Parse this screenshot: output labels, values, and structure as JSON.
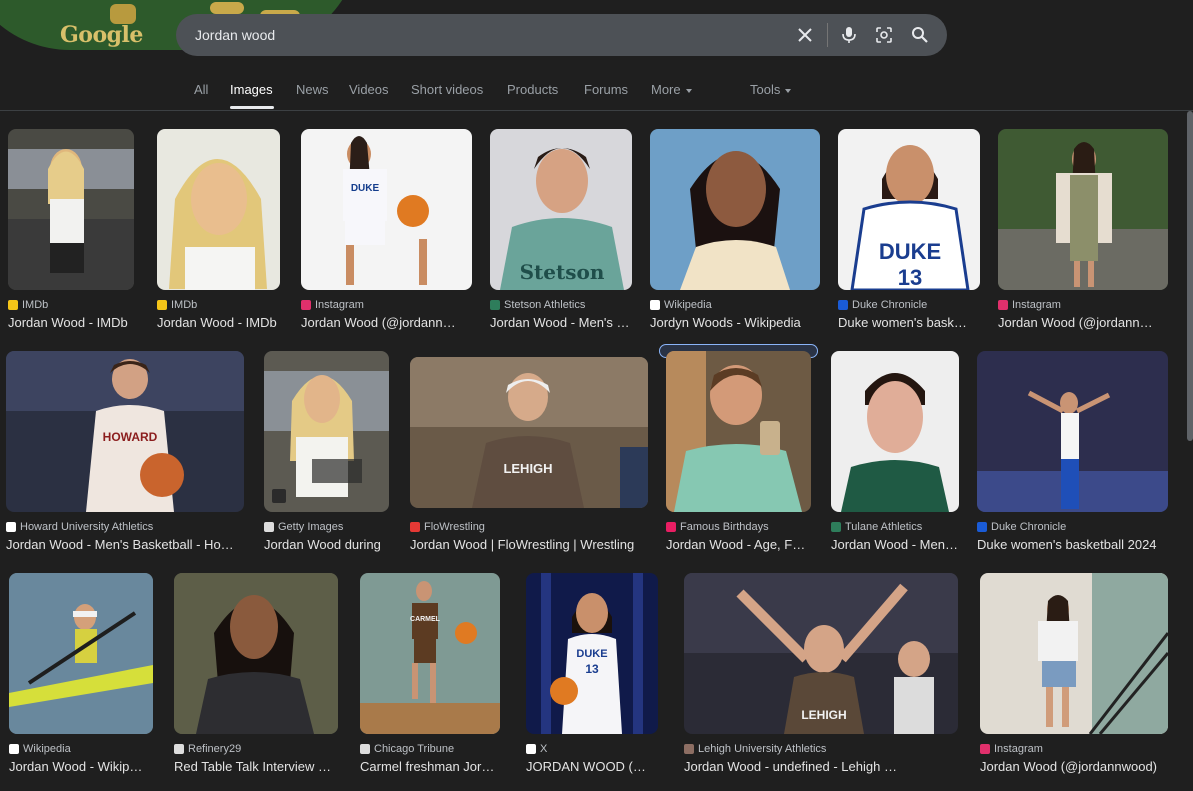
{
  "logo": {
    "text": "Google"
  },
  "search": {
    "value": "Jordan wood",
    "placeholder": ""
  },
  "icons": {
    "clear": "close-icon",
    "voice": "microphone-icon",
    "lens": "camera-lens-icon",
    "search": "search-icon"
  },
  "tabs": [
    {
      "label": "All"
    },
    {
      "label": "Images"
    },
    {
      "label": "News"
    },
    {
      "label": "Videos"
    },
    {
      "label": "Short videos"
    },
    {
      "label": "Products"
    },
    {
      "label": "Forums"
    },
    {
      "label": "More"
    },
    {
      "label": "Tools"
    }
  ],
  "results": [
    {
      "source": "IMDb",
      "title": "Jordan Wood - IMDb",
      "favicon_color": "#f5c518"
    },
    {
      "source": "IMDb",
      "title": "Jordan Wood - IMDb",
      "favicon_color": "#f5c518"
    },
    {
      "source": "Instagram",
      "title": "Jordan Wood (@jordannwood)",
      "favicon_color": "#e1306c"
    },
    {
      "source": "Stetson Athletics",
      "title": "Jordan Wood - Men's Basketball",
      "favicon_color": "#2e7d5b"
    },
    {
      "source": "Wikipedia",
      "title": "Jordyn Woods - Wikipedia",
      "favicon_color": "#ffffff"
    },
    {
      "source": "Duke Chronicle",
      "title": "Duke women's basketball",
      "favicon_color": "#1a5bd6"
    },
    {
      "source": "Instagram",
      "title": "Jordan Wood (@jordannwood)",
      "favicon_color": "#e1306c"
    },
    {
      "source": "Howard University Athletics",
      "title": "Jordan Wood - Men's Basketball - Howard",
      "favicon_color": "#ffffff"
    },
    {
      "source": "Getty Images",
      "title": "Jordan Wood during",
      "favicon_color": "#dddddd"
    },
    {
      "source": "FloWrestling",
      "title": "Jordan Wood | FloWrestling | Wrestling",
      "favicon_color": "#e53935"
    },
    {
      "source": "Famous Birthdays",
      "title": "Jordan Wood - Age, Family, Bio",
      "favicon_color": "#e91e63"
    },
    {
      "source": "Tulane Athletics",
      "title": "Jordan Wood - Men's Basketball",
      "favicon_color": "#2e7d5b"
    },
    {
      "source": "Duke Chronicle",
      "title": "Duke women's basketball 2024",
      "favicon_color": "#1a5bd6"
    },
    {
      "source": "Wikipedia",
      "title": "Jordan Wood - Wikipedia",
      "favicon_color": "#ffffff"
    },
    {
      "source": "Refinery29",
      "title": "Red Table Talk Interview Jordyn Woods",
      "favicon_color": "#dddddd"
    },
    {
      "source": "Chicago Tribune",
      "title": "Carmel freshman Jordan Wood",
      "favicon_color": "#dddddd"
    },
    {
      "source": "X",
      "title": "JORDAN WOOD (@jordanwood)",
      "favicon_color": "#ffffff"
    },
    {
      "source": "Lehigh University Athletics",
      "title": "Jordan Wood - undefined - Lehigh University",
      "favicon_color": "#8d6e63"
    },
    {
      "source": "Instagram",
      "title": "Jordan Wood (@jordannwood)",
      "favicon_color": "#e1306c"
    }
  ],
  "colors": {
    "background": "#1f1f1f",
    "search_box": "#4d5156",
    "selected_border": "#8ab4f8",
    "jersey_text": {
      "duke": "DUKE",
      "stetson": "Stetson",
      "howard": "HOWARD",
      "lehigh": "LEHIGH",
      "carmel": "CARMEL",
      "number": "13"
    }
  }
}
